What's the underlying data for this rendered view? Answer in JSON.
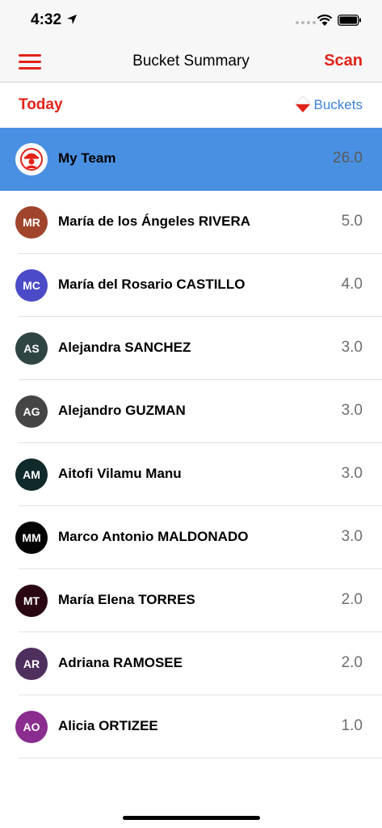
{
  "status_bar": {
    "time": "4:32"
  },
  "nav": {
    "title": "Bucket Summary",
    "scan_label": "Scan"
  },
  "sub_header": {
    "today_label": "Today",
    "buckets_label": "Buckets"
  },
  "colors": {
    "accent_red": "#e2231a",
    "link_blue": "#3b82d6",
    "selected_row": "#4a90e2"
  },
  "team": {
    "name": "My Team",
    "value": "26.0"
  },
  "members": [
    {
      "initials": "MR",
      "name": "María de los Ángeles RIVERA",
      "value": "5.0",
      "color": "#a0442c"
    },
    {
      "initials": "MC",
      "name": "María del Rosario CASTILLO",
      "value": "4.0",
      "color": "#4b4bc8"
    },
    {
      "initials": "AS",
      "name": "Alejandra SANCHEZ",
      "value": "3.0",
      "color": "#2e4544"
    },
    {
      "initials": "AG",
      "name": "Alejandro GUZMAN",
      "value": "3.0",
      "color": "#454545"
    },
    {
      "initials": "AM",
      "name": "Aitofi Vilamu Manu",
      "value": "3.0",
      "color": "#10292b"
    },
    {
      "initials": "MM",
      "name": "Marco Antonio MALDONADO",
      "value": "3.0",
      "color": "#050505"
    },
    {
      "initials": "MT",
      "name": "María Elena TORRES",
      "value": "2.0",
      "color": "#2a0612"
    },
    {
      "initials": "AR",
      "name": "Adriana RAMOSEE",
      "value": "2.0",
      "color": "#4e2f5e"
    },
    {
      "initials": "AO",
      "name": "Alicia ORTIZEE",
      "value": "1.0",
      "color": "#8a2d8f"
    }
  ]
}
